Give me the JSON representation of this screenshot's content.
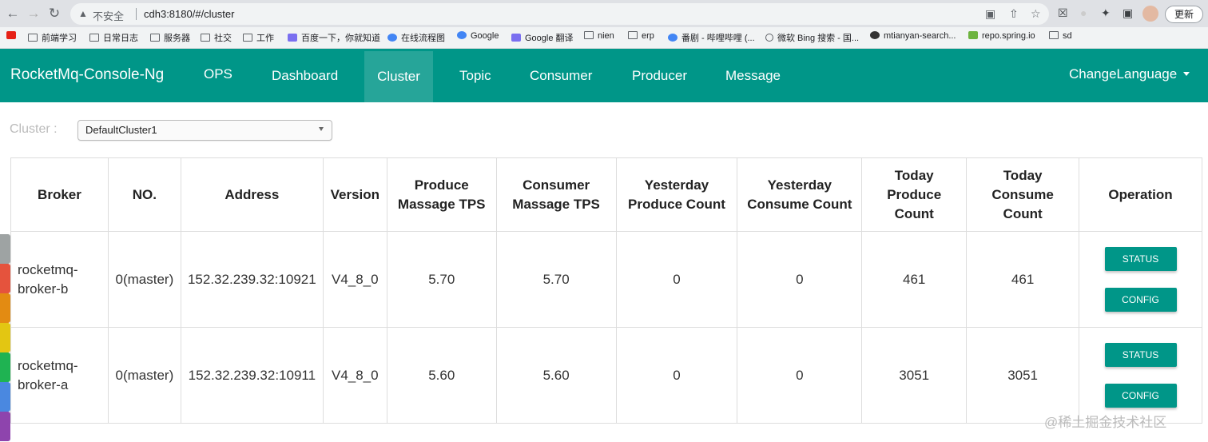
{
  "browser": {
    "insecure_label": "不安全",
    "url": "cdh3:8180/#/cluster",
    "update_label": "更新"
  },
  "bookmarks": [
    {
      "label": "前端学习",
      "icon": "folder-icon"
    },
    {
      "label": "日常日志",
      "icon": "folder-icon"
    },
    {
      "label": "服务器",
      "icon": "folder-icon"
    },
    {
      "label": "社交",
      "icon": "folder-icon"
    },
    {
      "label": "工作",
      "icon": "folder-icon"
    },
    {
      "label": "百度一下，你就知道",
      "icon": "baidu-icon"
    },
    {
      "label": "在线流程图",
      "icon": "on-icon"
    },
    {
      "label": "Google",
      "icon": "google-icon"
    },
    {
      "label": "Google 翻译",
      "icon": "translate-icon"
    },
    {
      "label": "nien",
      "icon": "folder-icon"
    },
    {
      "label": "erp",
      "icon": "folder-icon"
    },
    {
      "label": "番剧 - 哔哩哔哩 (...",
      "icon": "bilibili-icon"
    },
    {
      "label": "微软 Bing 搜索 - 国...",
      "icon": "search-icon"
    },
    {
      "label": "mtianyan-search...",
      "icon": "github-icon"
    },
    {
      "label": "repo.spring.io",
      "icon": "spring-icon"
    },
    {
      "label": "sd",
      "icon": "folder-icon"
    }
  ],
  "app": {
    "brand": "RocketMq-Console-Ng",
    "nav": [
      "OPS",
      "Dashboard",
      "Cluster",
      "Topic",
      "Consumer",
      "Producer",
      "Message"
    ],
    "active_nav": "Cluster",
    "change_language": "ChangeLanguage"
  },
  "cluster": {
    "label": "Cluster :",
    "selected": "DefaultCluster1"
  },
  "table": {
    "headers": {
      "broker": "Broker",
      "no": "NO.",
      "address": "Address",
      "version": "Version",
      "produce_tps_1": "Produce",
      "produce_tps_2": "Massage TPS",
      "consumer_tps_1": "Consumer",
      "consumer_tps_2": "Massage TPS",
      "yesterday_produce_1": "Yesterday",
      "yesterday_produce_2": "Produce Count",
      "yesterday_consume_1": "Yesterday",
      "yesterday_consume_2": "Consume Count",
      "today_produce_1": "Today",
      "today_produce_2": "Produce",
      "today_produce_3": "Count",
      "today_consume_1": "Today",
      "today_consume_2": "Consume",
      "today_consume_3": "Count",
      "operation": "Operation"
    },
    "rows": [
      {
        "broker_1": "rocketmq-",
        "broker_2": "broker-b",
        "no": "0(master)",
        "address": "152.32.239.32:10921",
        "version": "V4_8_0",
        "produce_tps": "5.70",
        "consumer_tps": "5.70",
        "yesterday_produce": "0",
        "yesterday_consume": "0",
        "today_produce": "461",
        "today_consume": "461",
        "status_label": "STATUS",
        "config_label": "CONFIG"
      },
      {
        "broker_1": "rocketmq-",
        "broker_2": "broker-a",
        "no": "0(master)",
        "address": "152.32.239.32:10911",
        "version": "V4_8_0",
        "produce_tps": "5.60",
        "consumer_tps": "5.60",
        "yesterday_produce": "0",
        "yesterday_consume": "0",
        "today_produce": "3051",
        "today_consume": "3051",
        "status_label": "STATUS",
        "config_label": "CONFIG"
      }
    ]
  },
  "watermark": "@稀土掘金技术社区",
  "colors": {
    "navbar": "#009688",
    "button": "#009688"
  }
}
